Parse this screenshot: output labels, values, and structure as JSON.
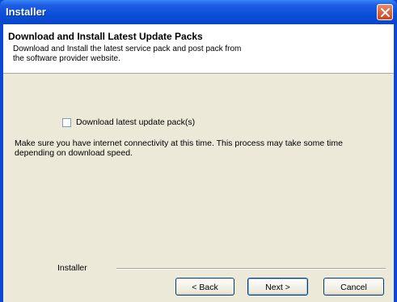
{
  "window": {
    "title": "Installer",
    "close_icon": "close-icon"
  },
  "header": {
    "title": "Download and Install Latest Update Packs",
    "description": "Download and Install the latest service pack and post pack from the software provider website."
  },
  "content": {
    "checkbox_label": "Download latest update pack(s)",
    "checkbox_checked": false,
    "note": "Make sure you have internet connectivity at this time. This process may take some time depending on download speed."
  },
  "footer": {
    "brand": "Installer",
    "back_label": "< Back",
    "next_label": "Next >",
    "cancel_label": "Cancel"
  }
}
